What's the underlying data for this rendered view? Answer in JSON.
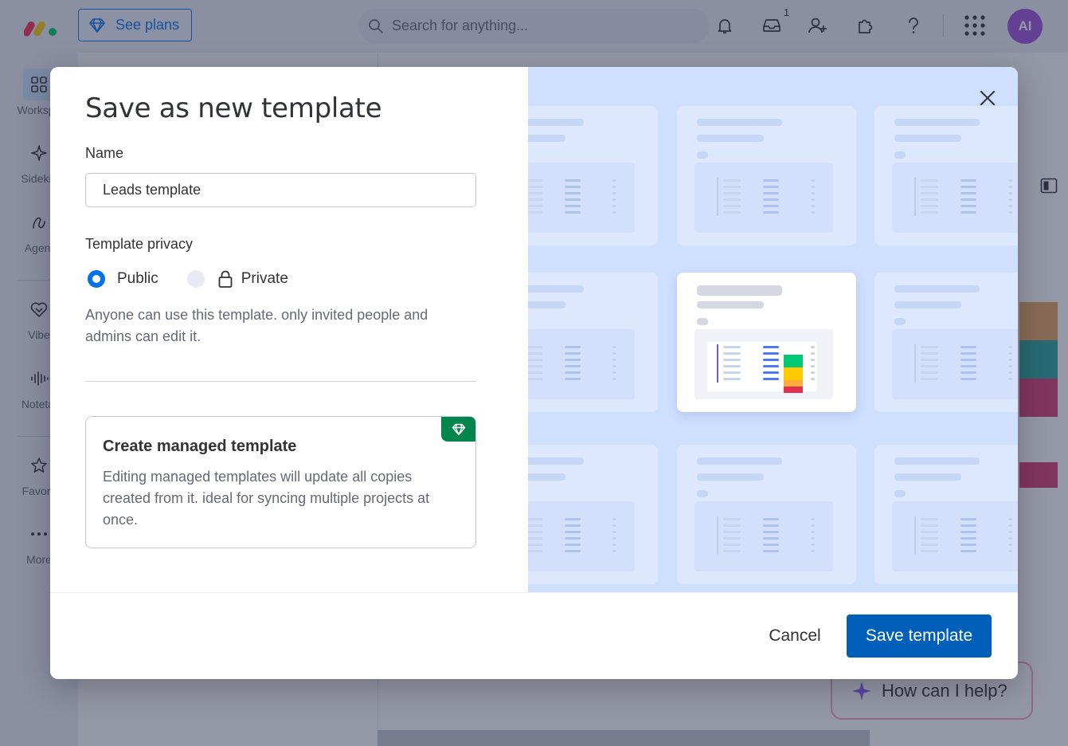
{
  "app": {
    "see_plans_label": "See plans",
    "search_placeholder": "Search for anything...",
    "inbox_badge": "1",
    "avatar_initials": "AI",
    "help_chip_label": "How can I help?"
  },
  "leftnav": {
    "items": [
      {
        "label": "Workspa",
        "icon": "grid-icon"
      },
      {
        "label": "Sidekic",
        "icon": "sparkle-icon"
      },
      {
        "label": "Agent",
        "icon": "agent-icon"
      },
      {
        "label": "Vibe",
        "icon": "heart-icon"
      },
      {
        "label": "Notetal",
        "icon": "waveform-icon"
      },
      {
        "label": "Favorit",
        "icon": "star-icon"
      },
      {
        "label": "More",
        "icon": "more-dots-icon"
      }
    ]
  },
  "modal": {
    "title": "Save as new template",
    "name_label": "Name",
    "name_value": "Leads template",
    "privacy_label": "Template privacy",
    "privacy_options": [
      {
        "label": "Public",
        "selected": true
      },
      {
        "label": "Private",
        "selected": false,
        "icon": "lock-icon"
      }
    ],
    "privacy_helper": "Anyone can use this template. only invited people and admins can edit it.",
    "managed_title": "Create managed template",
    "managed_desc": "Editing managed templates will update all copies created from it. ideal for syncing multiple projects at once.",
    "cancel_label": "Cancel",
    "save_label": "Save template"
  },
  "colors": {
    "accent": "#0073ea",
    "save_button": "#0060b9",
    "premium_badge": "#00854d",
    "preview_bg": "#cfe0ff",
    "status_green": "#00c875",
    "status_yellow": "#ffcb00",
    "status_orange": "#fdab3d",
    "status_red": "#df2f4a"
  }
}
